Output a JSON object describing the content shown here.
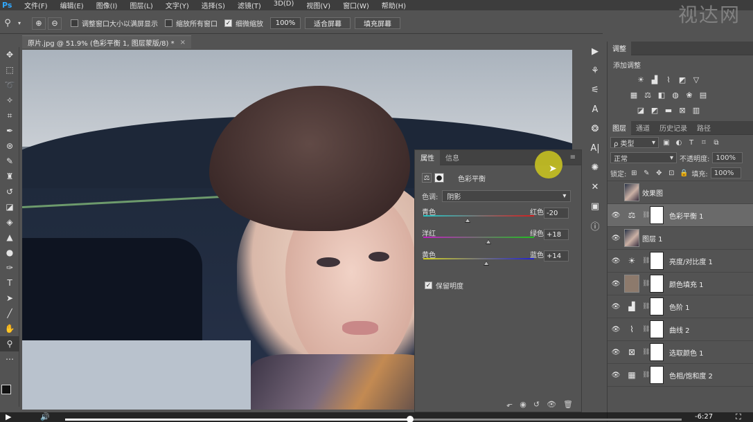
{
  "app": {
    "logo": "Ps",
    "watermark": "视达网"
  },
  "menu": [
    "文件(F)",
    "编辑(E)",
    "图像(I)",
    "图层(L)",
    "文字(Y)",
    "选择(S)",
    "滤镜(T)",
    "3D(D)",
    "视图(V)",
    "窗口(W)",
    "帮助(H)"
  ],
  "options": {
    "resize_window": "调整窗口大小以满屏显示",
    "zoom_all": "缩放所有窗口",
    "scrubby_zoom": "细微缩放",
    "zoom_value": "100%",
    "fit_screen": "适合屏幕",
    "fill_screen": "填充屏幕"
  },
  "document": {
    "tab_title": "原片.jpg @ 51.9% (色彩平衡 1, 图层蒙版/8) *",
    "close": "×"
  },
  "properties": {
    "tabs": [
      "属性",
      "信息"
    ],
    "panel_label": "色彩平衡",
    "tone_label": "色调:",
    "tone_value": "阴影",
    "sliders": [
      {
        "left": "青色",
        "right": "红色",
        "value": "-20",
        "number": -20,
        "gradient": [
          "#21c6c6",
          "#d02020"
        ]
      },
      {
        "left": "洋红",
        "right": "绿色",
        "value": "+18",
        "number": 18,
        "gradient": [
          "#c020c0",
          "#20c020"
        ]
      },
      {
        "left": "黄色",
        "right": "蓝色",
        "value": "+14",
        "number": 14,
        "gradient": [
          "#d0d020",
          "#2020d0"
        ]
      }
    ],
    "preserve": "保留明度"
  },
  "adjustments": {
    "tab": "调整",
    "add_label": "添加调整"
  },
  "layers_panel": {
    "tabs": [
      "图层",
      "通道",
      "历史记录",
      "路径"
    ],
    "kind_filter": "ρ 类型",
    "blend_mode": "正常",
    "opacity_label": "不透明度:",
    "opacity_value": "100%",
    "lock_label": "锁定:",
    "fill_label": "填充:",
    "fill_value": "100%",
    "layers": [
      {
        "name": "效果图",
        "visible": false,
        "type": "image",
        "mask": false,
        "active": false
      },
      {
        "name": "色彩平衡 1",
        "visible": true,
        "type": "adjust",
        "icon": "⚖",
        "mask": true,
        "active": true
      },
      {
        "name": "图层 1",
        "visible": true,
        "type": "image",
        "mask": false,
        "active": false
      },
      {
        "name": "亮度/对比度 1",
        "visible": true,
        "type": "adjust",
        "icon": "☀",
        "mask": true,
        "active": false
      },
      {
        "name": "颜色填充 1",
        "visible": true,
        "type": "fill",
        "color": "#8d7a6c",
        "mask": true,
        "active": false
      },
      {
        "name": "色阶 1",
        "visible": true,
        "type": "adjust",
        "icon": "▟",
        "mask": true,
        "active": false
      },
      {
        "name": "曲线 2",
        "visible": true,
        "type": "adjust",
        "icon": "⌇",
        "mask": true,
        "active": false
      },
      {
        "name": "选取颜色 1",
        "visible": true,
        "type": "adjust",
        "icon": "⊠",
        "mask": true,
        "active": false
      },
      {
        "name": "色相/饱和度 2",
        "visible": true,
        "type": "adjust",
        "icon": "▦",
        "mask": true,
        "active": false
      }
    ]
  },
  "video": {
    "time": "-6:27",
    "progress": 0.56
  },
  "colors": {
    "accent": "#31a8ff",
    "cursor": "#cec81e"
  }
}
